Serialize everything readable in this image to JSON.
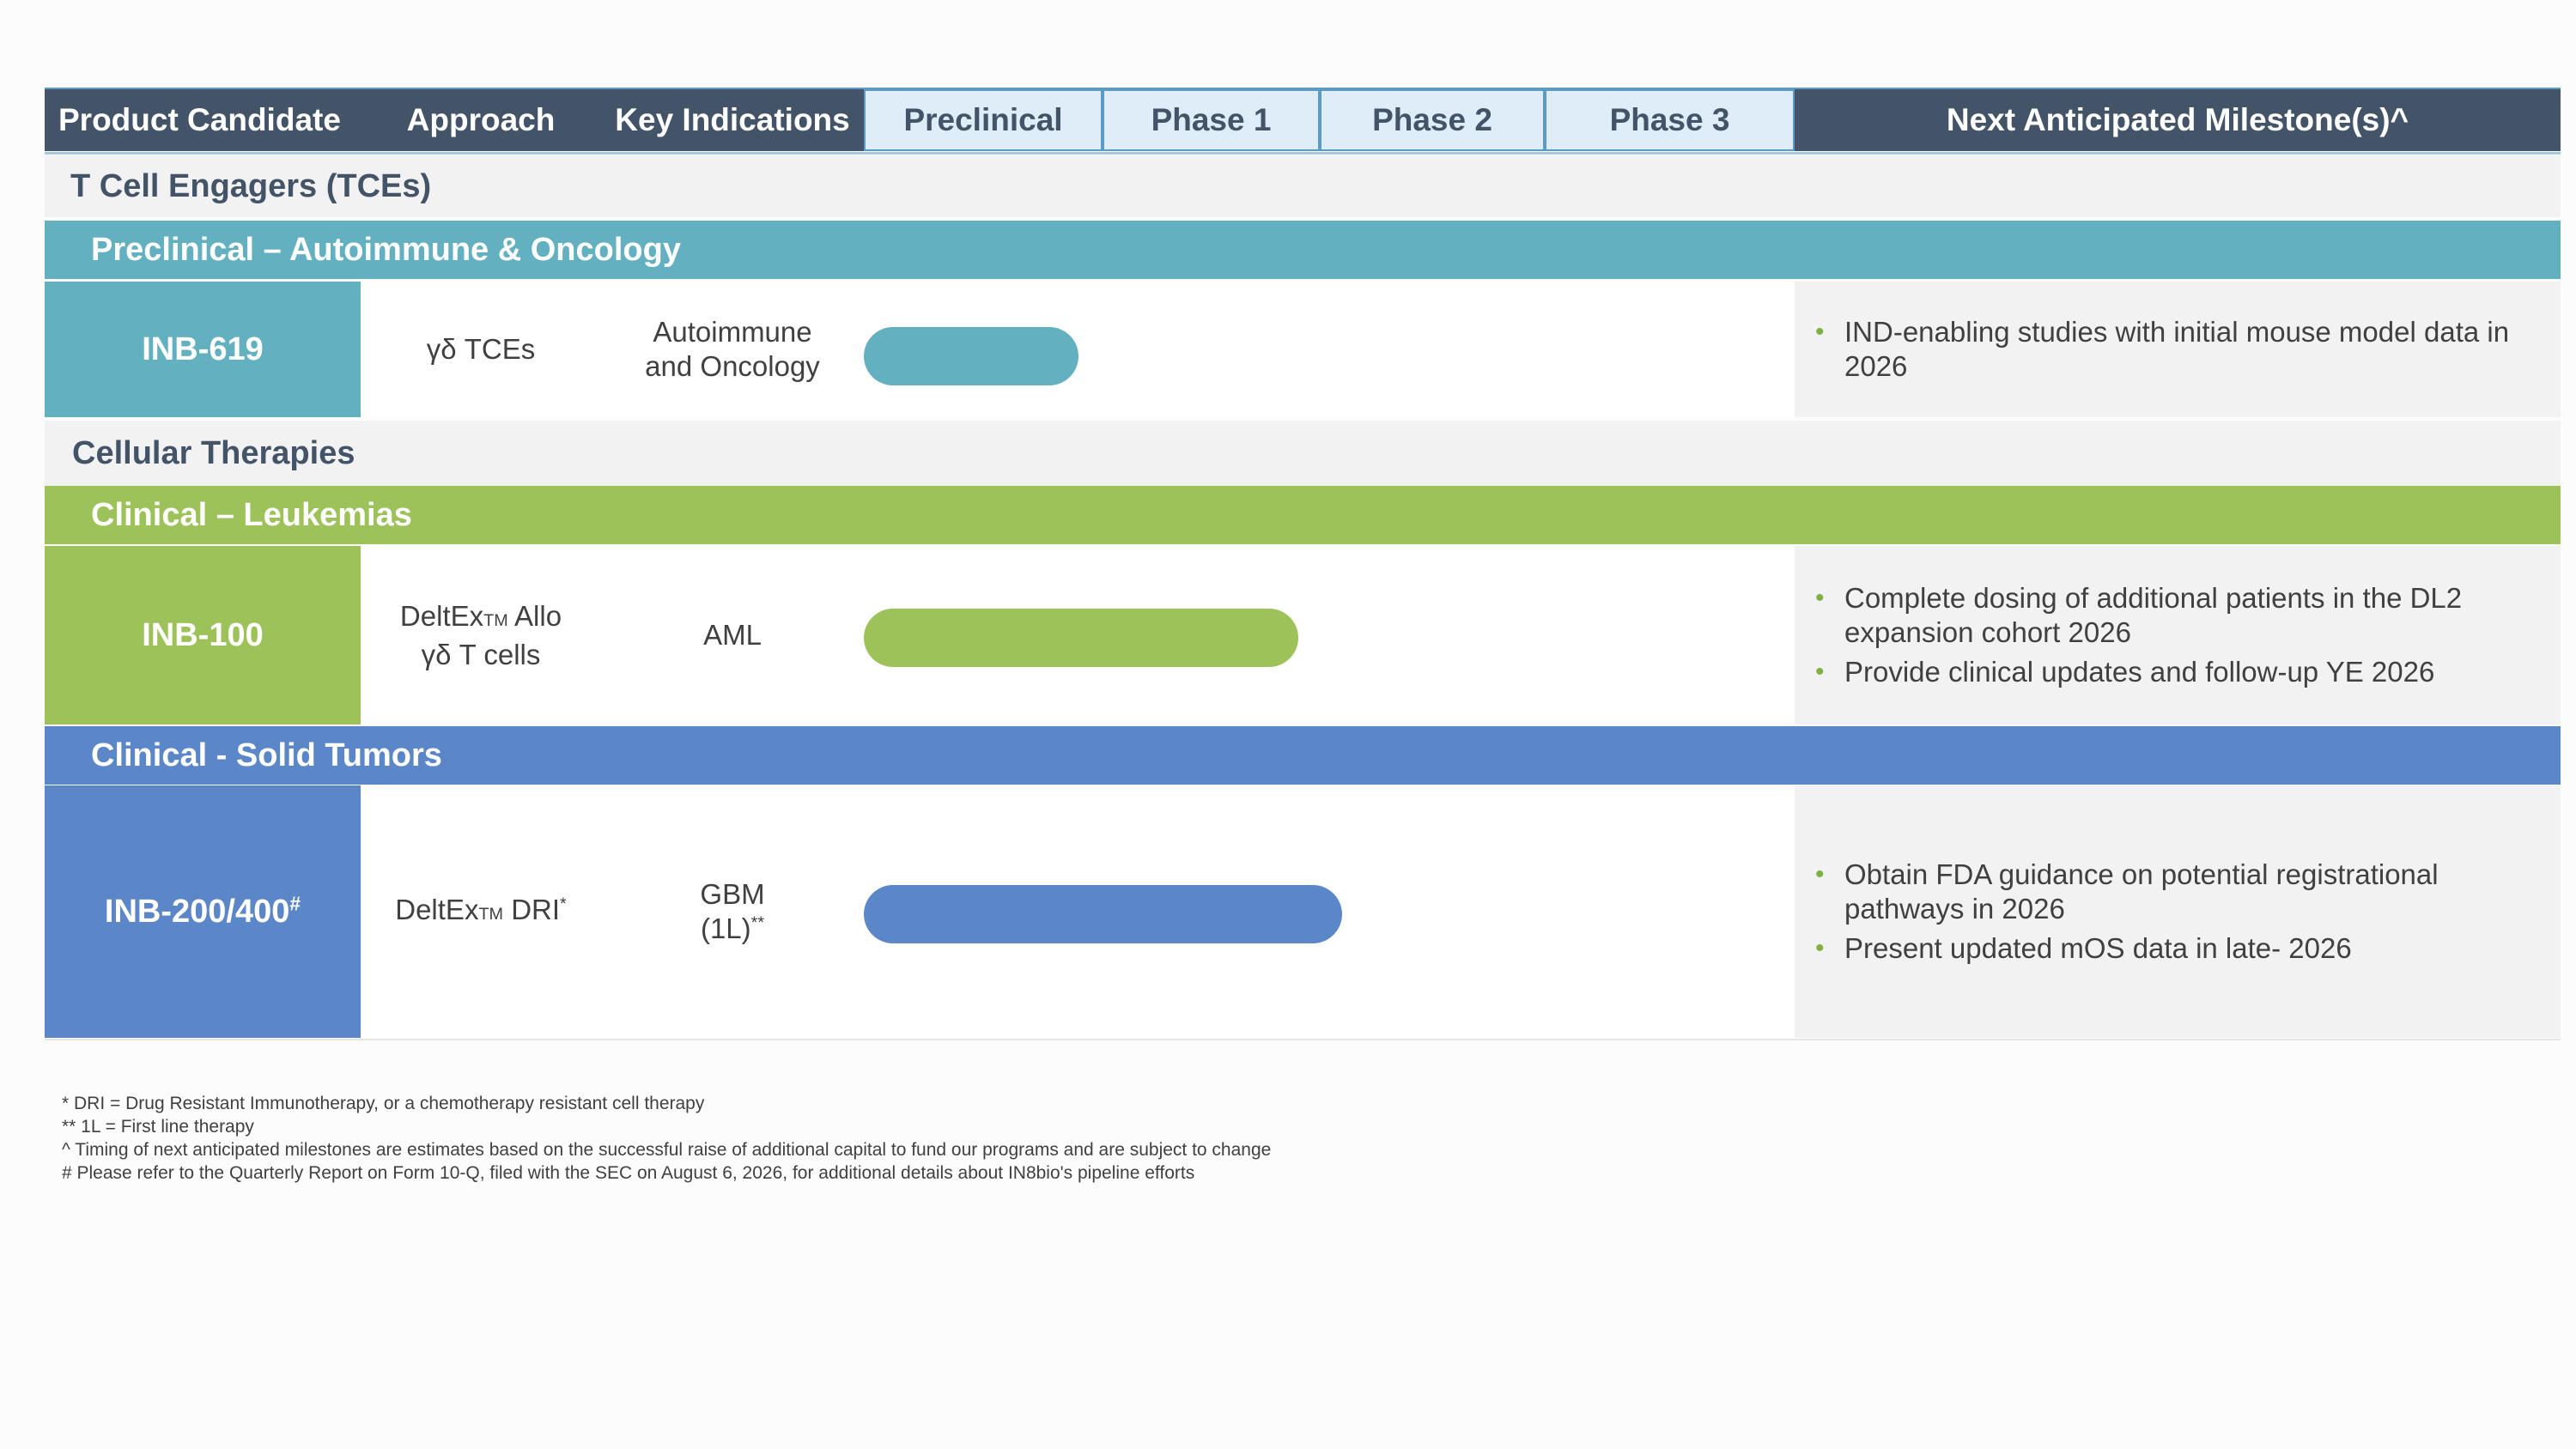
{
  "chart_data": {
    "type": "table",
    "phases": [
      "Preclinical",
      "Phase 1",
      "Phase 2",
      "Phase 3"
    ],
    "headers": {
      "product": "Product Candidate",
      "approach": "Approach",
      "indications": "Key Indications",
      "preclinical": "Preclinical",
      "phase1": "Phase 1",
      "phase2": "Phase 2",
      "phase3": "Phase 3",
      "milestones": "Next Anticipated Milestone(s)^"
    },
    "colors": {
      "header": "#435469",
      "phase_header_bg": "#dfedf8",
      "teal": "#63b1c0",
      "green": "#9dc25a",
      "blue": "#5b87c9",
      "bullet": "#7eb141"
    },
    "sections": [
      {
        "title": "T Cell Engagers (TCEs)",
        "subsections": [
          {
            "title": "Preclinical – Autoimmune & Oncology",
            "color": "#63b1c0",
            "rows": [
              {
                "candidate": "INB-619",
                "candidate_sup": "",
                "approach": [
                  "γδ TCEs"
                ],
                "approach_tm": "",
                "approach_sup": "",
                "indication": [
                  "Autoimmune",
                  "and Oncology"
                ],
                "indication_sup": "",
                "progress_phases": 0.9,
                "milestones": [
                  "IND-enabling studies with initial mouse model data in 2026"
                ]
              }
            ]
          }
        ]
      },
      {
        "title": "Cellular Therapies",
        "subsections": [
          {
            "title": "Clinical – Leukemias",
            "color": "#9dc25a",
            "rows": [
              {
                "candidate": "INB-100",
                "candidate_sup": "",
                "approach": [
                  "DeltEx",
                  "Allo",
                  "γδ T cells"
                ],
                "approach_tm": "TM",
                "approach_sup": "",
                "indication": [
                  "AML"
                ],
                "indication_sup": "",
                "progress_phases": 1.9,
                "milestones": [
                  "Complete dosing of additional patients in the DL2 expansion cohort 2026",
                  "Provide clinical updates and follow-up YE 2026"
                ]
              }
            ]
          },
          {
            "title": "Clinical - Solid Tumors",
            "color": "#5b87c9",
            "rows": [
              {
                "candidate": "INB-200/400",
                "candidate_sup": "#",
                "approach": [
                  "DeltEx",
                  "DRI"
                ],
                "approach_tm": "TM",
                "approach_sup": "*",
                "indication": [
                  "GBM",
                  "(1L)"
                ],
                "indication_sup": "**",
                "progress_phases": 2.1,
                "milestones": [
                  "Obtain FDA guidance on potential registrational pathways in 2026",
                  "Present updated mOS data in late- 2026"
                ]
              }
            ]
          }
        ]
      }
    ]
  },
  "footnotes": [
    "*  DRI = Drug Resistant Immunotherapy, or a chemotherapy resistant cell therapy",
    "** 1L = First line therapy",
    "^ Timing of next anticipated milestones are estimates based on the successful raise of additional capital to fund our programs and are subject to change",
    "# Please refer to the Quarterly Report on Form 10-Q, filed with the SEC on August 6, 2026, for additional details about IN8bio's pipeline efforts"
  ]
}
